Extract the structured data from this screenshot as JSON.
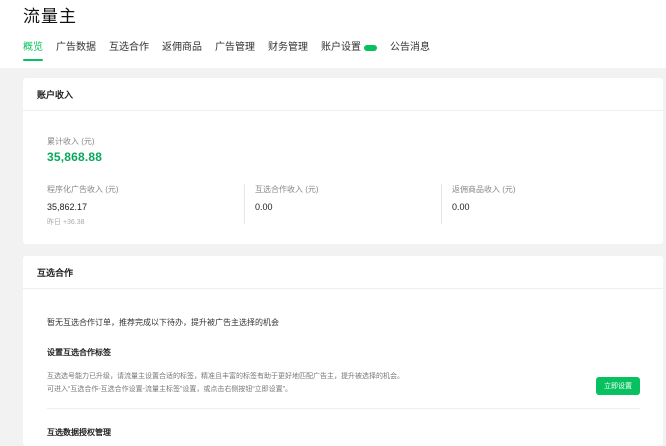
{
  "app": {
    "title": "流量主"
  },
  "nav": {
    "tabs": [
      {
        "label": "概览",
        "active": true
      },
      {
        "label": "广告数据"
      },
      {
        "label": "互选合作"
      },
      {
        "label": "返佣商品"
      },
      {
        "label": "广告管理"
      },
      {
        "label": "财务管理"
      },
      {
        "label": "账户设置",
        "badge": "new-badge"
      },
      {
        "label": "公告消息"
      }
    ]
  },
  "income": {
    "title": "账户收入",
    "total_label": "累计收入 (元)",
    "total_value": "35,868.88",
    "columns": [
      {
        "label": "程序化广告收入 (元)",
        "value": "35,862.17",
        "sub": "昨日 +36.38"
      },
      {
        "label": "互选合作收入 (元)",
        "value": "0.00"
      },
      {
        "label": "返佣商品收入 (元)",
        "value": "0.00"
      }
    ]
  },
  "mutual": {
    "title": "互选合作",
    "tip": "暂无互选合作订单，推荐完成以下待办，提升被广告主选择的机会",
    "setting_title": "设置互选合作标签",
    "setting_desc_1": "互选选号能力已升级，请流量主设置合适的标签，精准且丰富的标签有助于更好地匹配广告主，提升被选择的机会。",
    "setting_desc_2": "可进入“互选合作-互选合作设置-流量主标签”设置，或点击右侧按钮“立即设置”。",
    "setup_button": "立即设置",
    "data_auth_title": "互选数据授权管理"
  },
  "colors": {
    "accent": "#07c160",
    "accent_text": "#07a85a",
    "background": "#f2f2f2"
  }
}
